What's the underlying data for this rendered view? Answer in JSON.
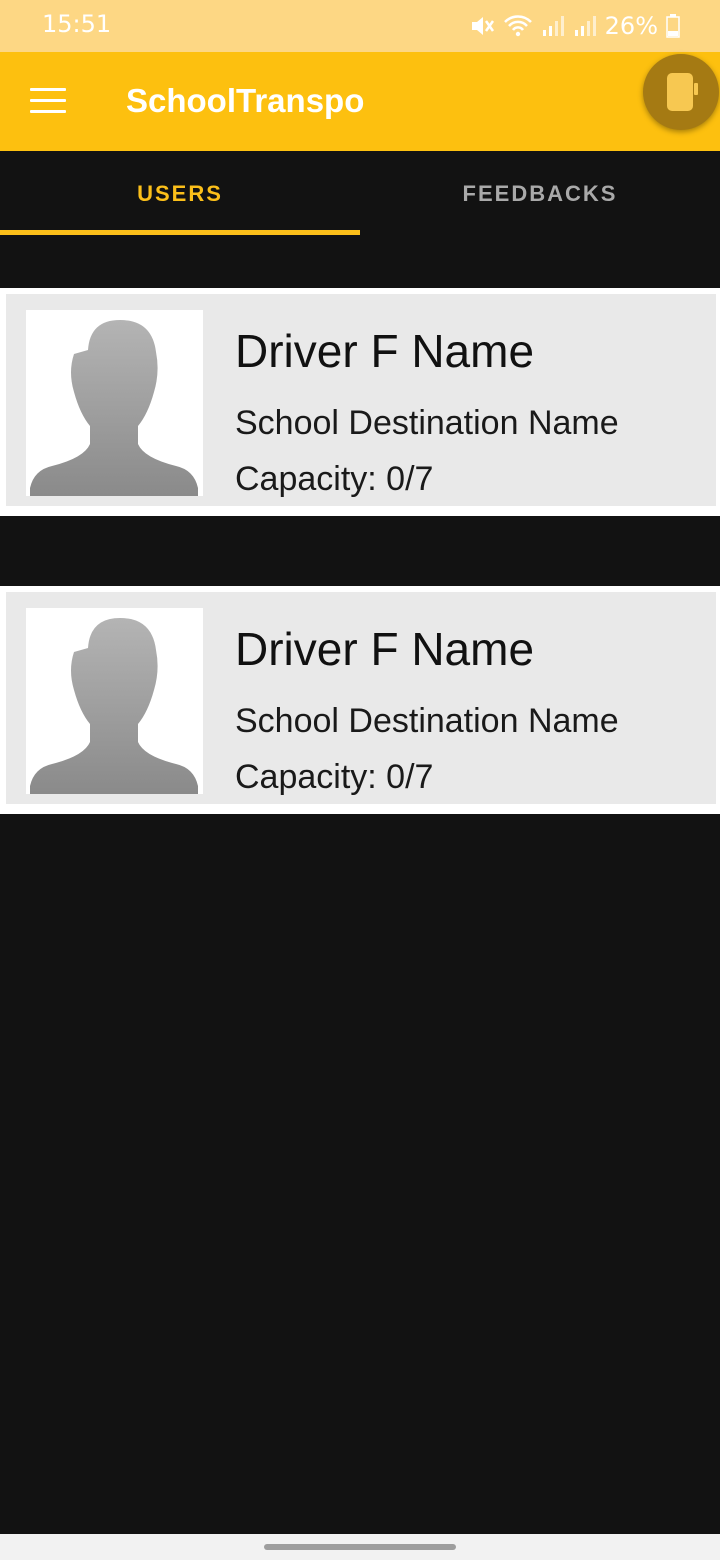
{
  "status_bar": {
    "time": "15:51",
    "battery": "26%",
    "icons": [
      "mute-icon",
      "wifi-icon",
      "signal-icon",
      "signal-icon",
      "battery-icon"
    ]
  },
  "app_bar": {
    "title": "SchoolTranspo",
    "menu_icon": "hamburger-menu-icon",
    "action_icon": "phone-icon",
    "colors": {
      "app_bar": "#fdc00f",
      "status_bar": "#fdd784",
      "fab": "#a57a13"
    }
  },
  "tabs": [
    {
      "label": "USERS",
      "selected": true
    },
    {
      "label": "FEEDBACKS",
      "selected": false
    }
  ],
  "accent_color": "#fbbf1a",
  "drivers": [
    {
      "name": "Driver F Name",
      "destination": "School Destination Name",
      "capacity": "Capacity: 0/7",
      "avatar_icon": "person-silhouette-icon"
    },
    {
      "name": "Driver F Name",
      "destination": "School Destination Name",
      "capacity": "Capacity: 0/7",
      "avatar_icon": "person-silhouette-icon"
    }
  ]
}
